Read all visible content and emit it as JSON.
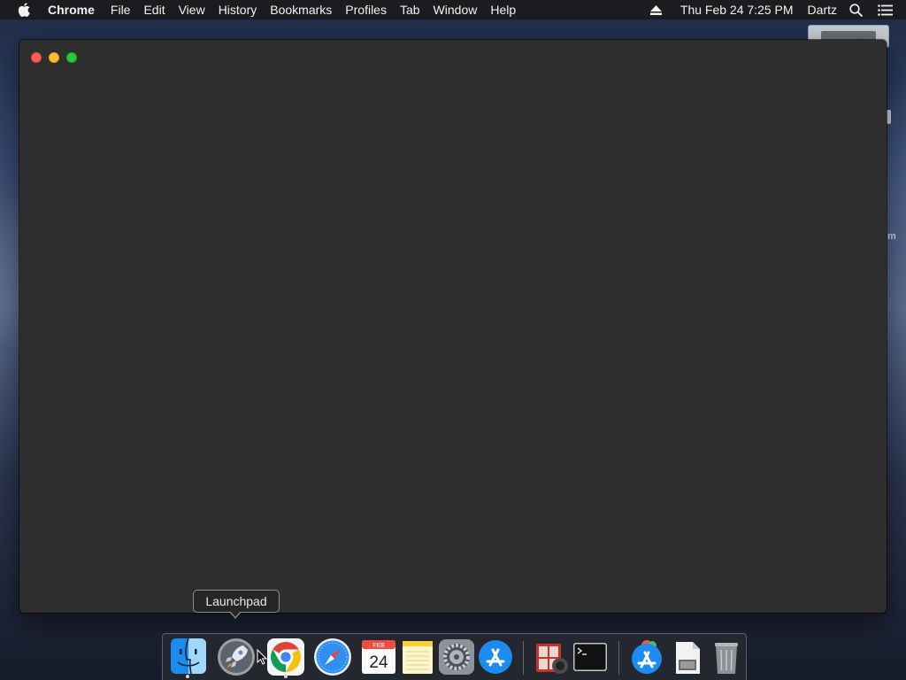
{
  "menubar": {
    "apple_icon": "apple-icon",
    "app_name": "Chrome",
    "menus": [
      "File",
      "Edit",
      "View",
      "History",
      "Bookmarks",
      "Profiles",
      "Tab",
      "Window",
      "Help"
    ],
    "clock": "Thu Feb 24  7:25 PM",
    "user": "Dartz",
    "status_icons": [
      "eject-icon",
      "spotlight-search-icon",
      "notification-center-icon"
    ]
  },
  "desktop": {
    "peek_text": "m"
  },
  "window": {
    "app": "Chrome",
    "background": "#2e2e2e",
    "traffic_colors": {
      "close": "#ff5f57",
      "minimize": "#febc2e",
      "zoom": "#28c840"
    }
  },
  "tooltip": {
    "text": "Launchpad"
  },
  "dock": {
    "items": [
      {
        "name": "Finder",
        "icon": "finder-icon",
        "running": true
      },
      {
        "name": "Launchpad",
        "icon": "launchpad-icon",
        "running": false
      },
      {
        "name": "Google Chrome",
        "icon": "chrome-icon",
        "running": true
      },
      {
        "name": "Safari",
        "icon": "safari-icon",
        "running": false
      },
      {
        "name": "Calendar",
        "icon": "calendar-icon",
        "running": false,
        "month": "FEB",
        "day": "24"
      },
      {
        "name": "Notes",
        "icon": "notes-icon",
        "running": false
      },
      {
        "name": "System Preferences",
        "icon": "system-preferences-icon",
        "running": false
      },
      {
        "name": "App Store",
        "icon": "app-store-icon",
        "running": false
      },
      {
        "name": "Photo Booth",
        "icon": "photo-booth-icon",
        "running": false
      },
      {
        "name": "Terminal",
        "icon": "terminal-icon",
        "running": false
      },
      {
        "name": "Downloads",
        "icon": "downloads-stack-icon",
        "running": false
      },
      {
        "name": "Document",
        "icon": "document-icon",
        "running": false
      },
      {
        "name": "Trash",
        "icon": "trash-icon",
        "running": false
      }
    ]
  }
}
